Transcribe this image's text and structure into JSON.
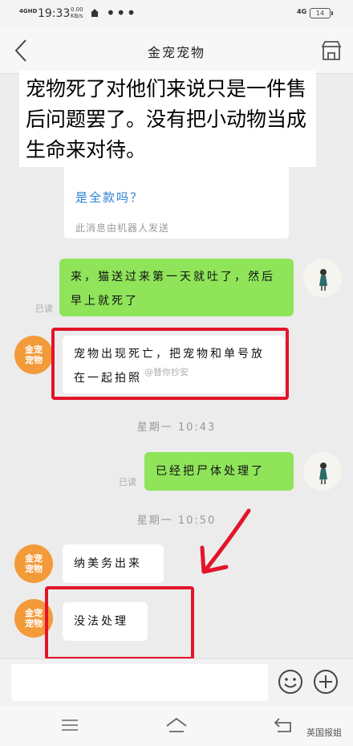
{
  "status_bar": {
    "signal": "4GHD",
    "time": "19:33",
    "speed": "0.00 KB/s",
    "dots": "•••",
    "network": "4G",
    "battery": "14"
  },
  "header": {
    "title": "金宠宠物"
  },
  "caption": "宠物死了对他们来说只是一件售后问题罢了。没有把小动物当成生命来对待。",
  "bot_card": {
    "question": "是全款吗？",
    "note": "此消息由机器人发送"
  },
  "messages": {
    "user1": "来，猫送过来第一天就吐了，然后早上就死了",
    "user1_read": "已读",
    "store1": "宠物出现死亡，把宠物和单号放在一起拍照",
    "time1": "星期一 10:43",
    "user2": "已经把尸体处理了",
    "user2_read": "已读",
    "time2": "星期一 10:50",
    "store2": "纳美务出来",
    "store3": "没法处理"
  },
  "avatar_store_label": "金宠\n宠物",
  "watermark_center": "@替你抄安",
  "watermark_corner": "英国报姐",
  "colors": {
    "green_bubble": "#8fe45a",
    "red_annotation": "#e2142a",
    "store_orange": "#f39a3a",
    "link_blue": "#2a7fd6"
  }
}
